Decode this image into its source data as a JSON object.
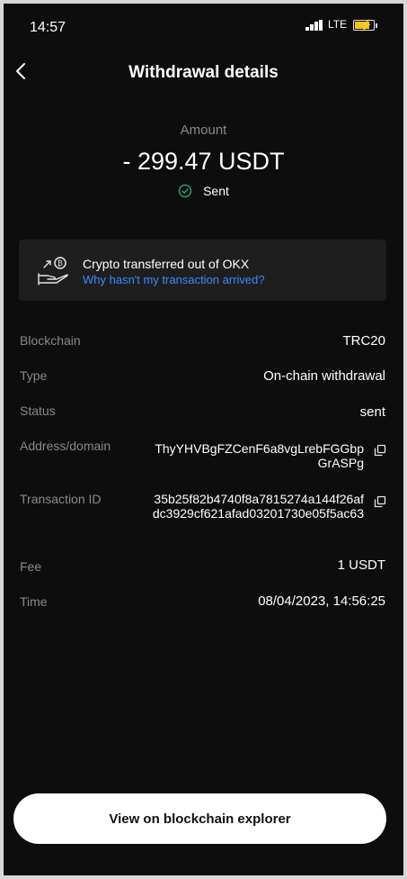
{
  "status_bar": {
    "time": "14:57",
    "network": "LTE"
  },
  "header": {
    "title": "Withdrawal details"
  },
  "amount": {
    "label": "Amount",
    "value": "- 299.47 USDT",
    "status": "Sent"
  },
  "notice": {
    "title": "Crypto transferred out of OKX",
    "link": "Why hasn't my transaction arrived?"
  },
  "details": {
    "blockchain": {
      "label": "Blockchain",
      "value": "TRC20"
    },
    "type": {
      "label": "Type",
      "value": "On-chain withdrawal"
    },
    "status": {
      "label": "Status",
      "value": "sent"
    },
    "address": {
      "label": "Address/domain",
      "value": "ThyYHVBgFZCenF6a8vgLrebFGGbpGrASPg"
    },
    "txid": {
      "label": "Transaction ID",
      "value": "35b25f82b4740f8a7815274a144f26afdc3929cf621afad03201730e05f5ac63"
    },
    "fee": {
      "label": "Fee",
      "value": "1 USDT"
    },
    "time": {
      "label": "Time",
      "value": "08/04/2023, 14:56:25"
    }
  },
  "footer": {
    "button_label": "View on blockchain explorer"
  },
  "colors": {
    "accent_link": "#3d8bff",
    "success": "#2f9e6e",
    "background": "#0d0d0d",
    "card": "#1e1e1e"
  },
  "icons": [
    "back-icon",
    "check-circle-icon",
    "crypto-transfer-hand-icon",
    "copy-icon",
    "signal-icon",
    "battery-charging-icon"
  ]
}
